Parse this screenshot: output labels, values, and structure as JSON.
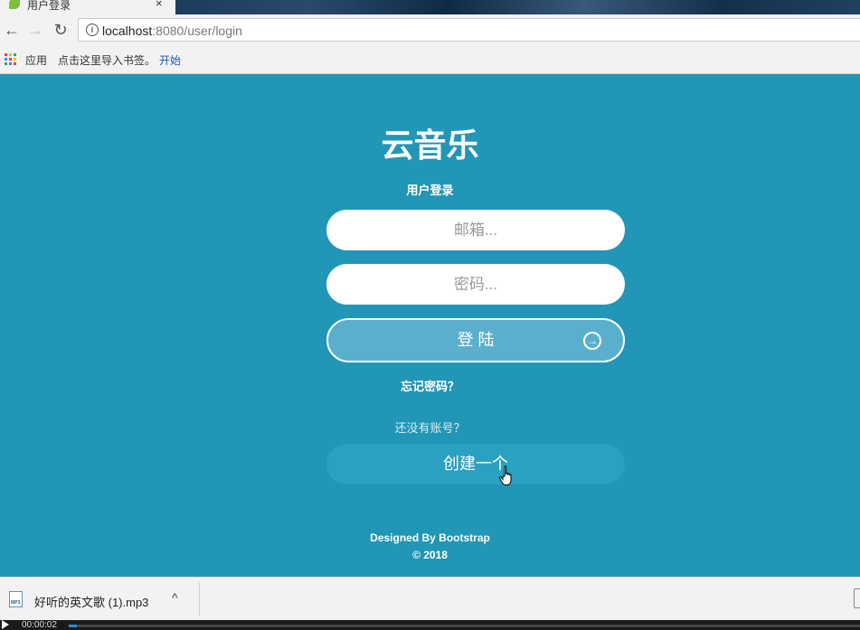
{
  "browser": {
    "tab_title": "用户登录",
    "tab_close": "×",
    "url_host": "localhost",
    "url_rest": ":8080/user/login",
    "back": "←",
    "forward": "→",
    "reload": "↻",
    "info": "i"
  },
  "bookmarks": {
    "apps_label": "应用",
    "hint": "点击这里导入书签。",
    "start_label": "开始",
    "apps_icon_colors": [
      "#e94235",
      "#fbbc04",
      "#34a853",
      "#4285f4",
      "#e94235",
      "#fbbc04",
      "#34a853",
      "#4285f4",
      "#e94235"
    ]
  },
  "page": {
    "brand": "云音乐",
    "subtitle": "用户登录",
    "email_placeholder": "邮箱...",
    "password_placeholder": "密码...",
    "login_label": "登 陆",
    "forgot_label": "忘记密码？",
    "no_account": "还没有账号？",
    "create_label": "创建一个",
    "footer_line1": "Designed By Bootstrap",
    "footer_line2": "© 2018",
    "colors": {
      "background": "#2196b6",
      "login_button": "#5ab0cc",
      "create_button": "#2aa1c2"
    }
  },
  "downloads": {
    "file_name": "好听的英文歌 (1).mp3",
    "file_ext": "MP3",
    "chevron": "^"
  },
  "player": {
    "time": "00:00:02",
    "progress": 0.01
  }
}
